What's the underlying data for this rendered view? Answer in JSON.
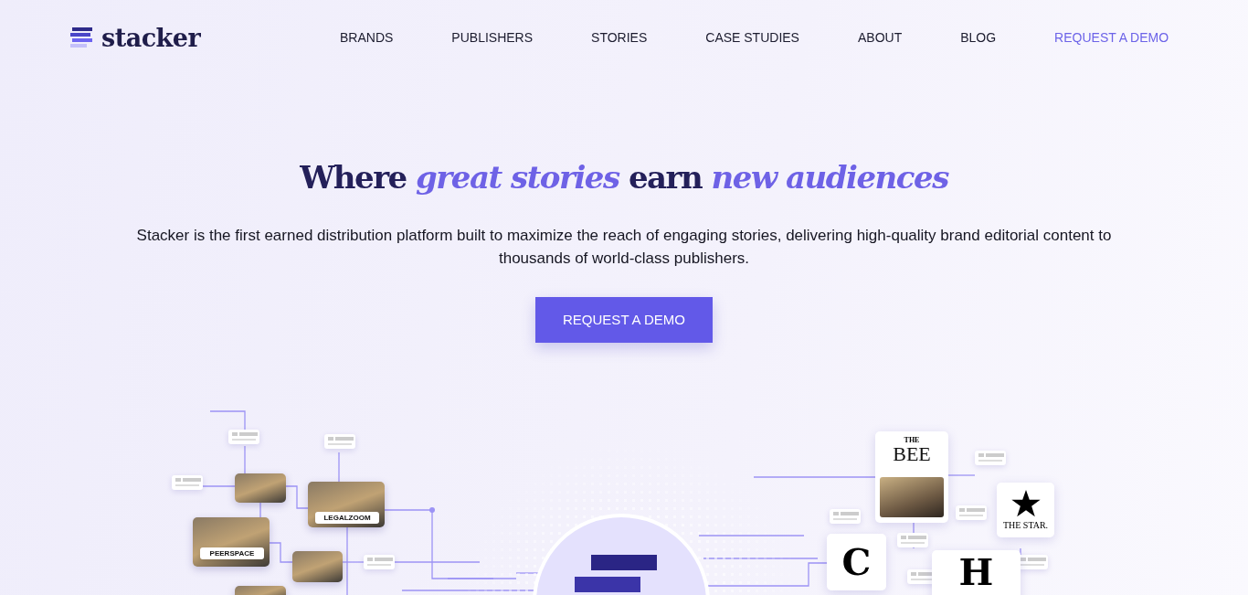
{
  "logo": {
    "text": "stacker"
  },
  "nav": [
    {
      "label": "BRANDS",
      "kind": "link"
    },
    {
      "label": "PUBLISHERS",
      "kind": "link"
    },
    {
      "label": "STORIES",
      "kind": "link"
    },
    {
      "label": "CASE STUDIES",
      "kind": "link"
    },
    {
      "label": "ABOUT",
      "kind": "link"
    },
    {
      "label": "BLOG",
      "kind": "link"
    },
    {
      "label": "REQUEST A DEMO",
      "kind": "cta"
    }
  ],
  "hero": {
    "title": "Where *great stories* earn *new audiences*",
    "description": "Stacker is the first earned distribution platform built to maximize the reach of engaging stories, delivering high-quality brand editorial content to thousands of world-class publishers.",
    "button": "REQUEST A DEMO"
  },
  "illustration": {
    "source_labels": [
      "LEGALZOOM",
      "PEERSPACE"
    ],
    "publishers": [
      {
        "kind": "bee",
        "top": "THE",
        "name": "BEE"
      },
      {
        "kind": "star",
        "name": "THE STAR."
      },
      {
        "kind": "letter",
        "name": "C"
      },
      {
        "kind": "letter",
        "name": "H"
      }
    ]
  }
}
